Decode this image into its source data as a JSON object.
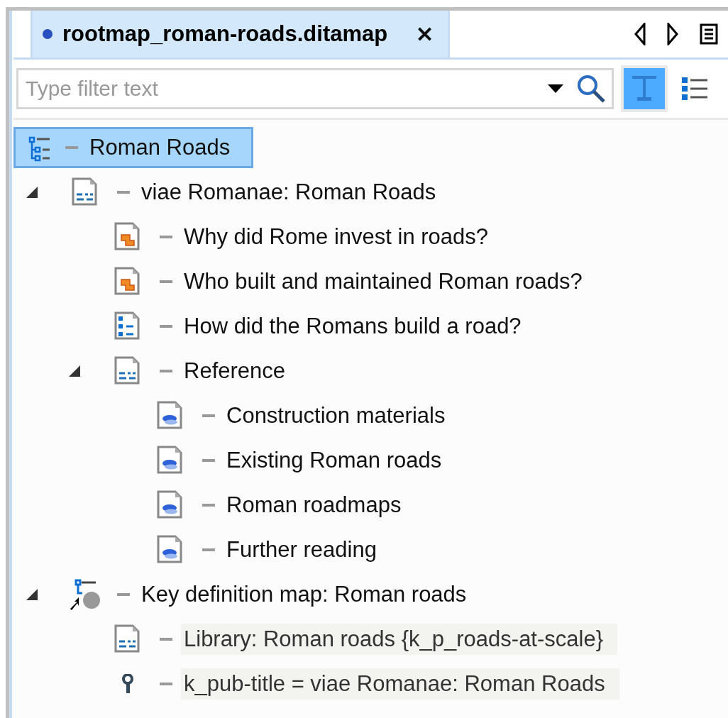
{
  "tab": {
    "title": "rootmap_roman-roads.ditamap",
    "modified": true,
    "selected": true,
    "close": "✕"
  },
  "filter": {
    "placeholder": "Type filter text",
    "text_filter_on": true
  },
  "tree": {
    "label": "Roman Roads",
    "kind": "map",
    "selected": true,
    "highlighted": false,
    "children": [
      {
        "label": "viae Romanae: Roman Roads",
        "kind": "topic",
        "expanded": true,
        "selected": false,
        "highlighted": false,
        "children": [
          {
            "label": "Why did Rome invest in roads?",
            "kind": "concept",
            "selected": false,
            "highlighted": false
          },
          {
            "label": "Who built and maintained Roman roads?",
            "kind": "concept",
            "selected": false,
            "highlighted": false
          },
          {
            "label": "How did the Romans build a road?",
            "kind": "task",
            "selected": false,
            "highlighted": false
          },
          {
            "label": "Reference",
            "kind": "topic",
            "expanded": true,
            "selected": false,
            "highlighted": false,
            "children": [
              {
                "label": "Construction materials",
                "kind": "reference",
                "selected": false,
                "highlighted": false
              },
              {
                "label": "Existing Roman roads",
                "kind": "reference",
                "selected": false,
                "highlighted": false
              },
              {
                "label": "Roman roadmaps",
                "kind": "reference",
                "selected": false,
                "highlighted": false
              },
              {
                "label": "Further reading",
                "kind": "reference",
                "selected": false,
                "highlighted": false
              }
            ]
          }
        ]
      },
      {
        "label": "Key definition map: Roman roads",
        "kind": "keymap",
        "expanded": true,
        "selected": false,
        "highlighted": false,
        "children": [
          {
            "label": "Library: Roman roads {k_p_roads-at-scale}",
            "kind": "topic",
            "selected": false,
            "highlighted": true
          },
          {
            "label": "k_pub-title = viae Romanae: Roman Roads",
            "kind": "key",
            "selected": false,
            "highlighted": true
          }
        ]
      }
    ]
  }
}
